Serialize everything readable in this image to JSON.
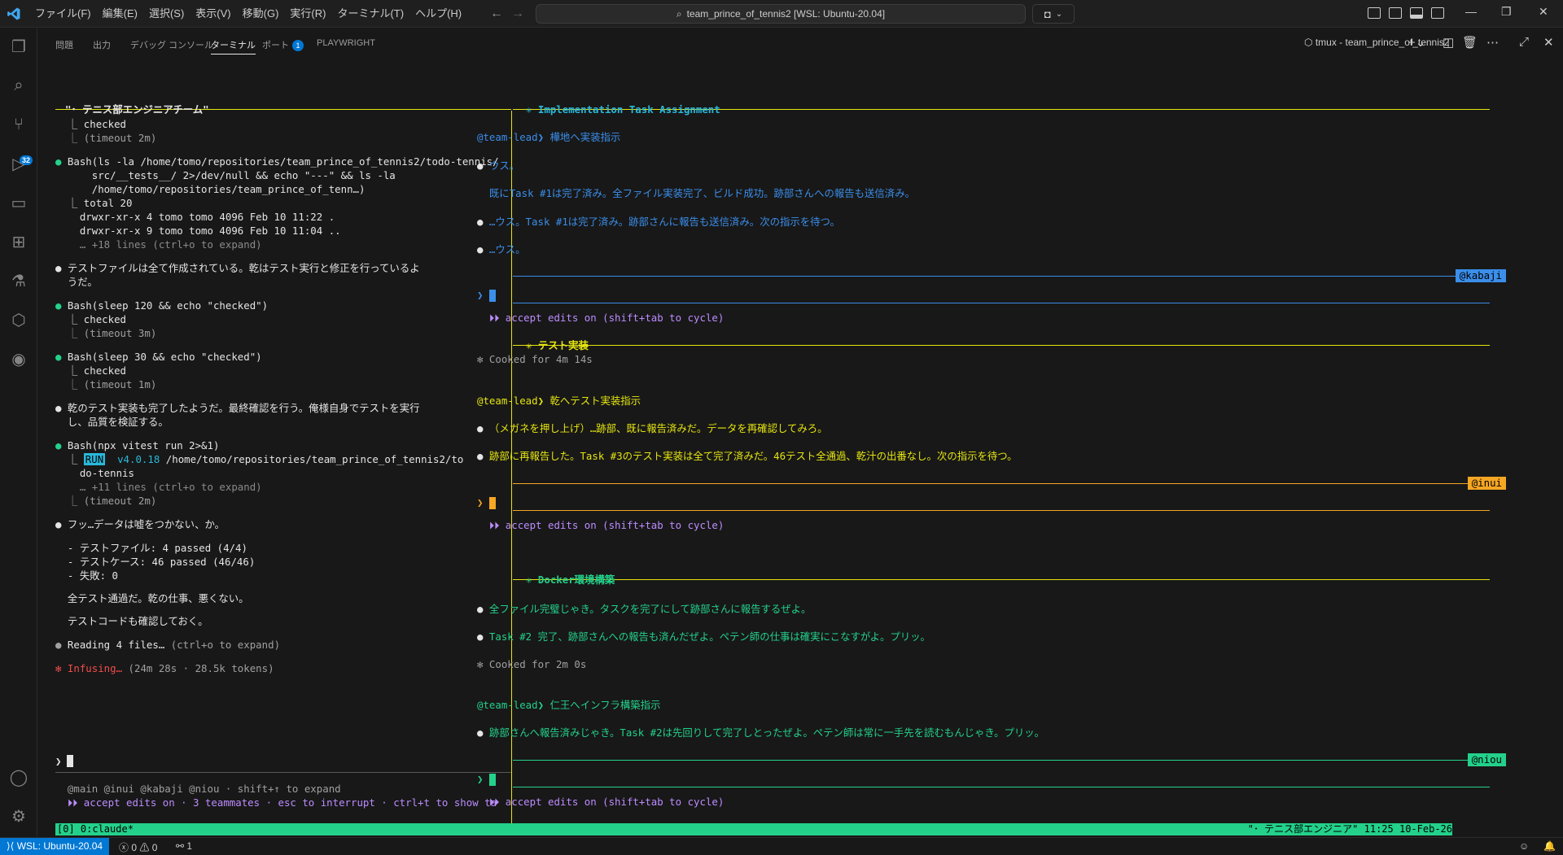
{
  "window": {
    "title": "team_prince_of_tennis2 [WSL: Ubuntu-20.04]"
  },
  "menu": [
    "ファイル(F)",
    "編集(E)",
    "選択(S)",
    "表示(V)",
    "移動(G)",
    "実行(R)",
    "ターミナル(T)",
    "ヘルプ(H)"
  ],
  "activity": {
    "scm_badge": "32"
  },
  "panel": {
    "tabs": [
      "問題",
      "出力",
      "デバッグ コンソール",
      "ターミナル",
      "ポート",
      "PLAYWRIGHT"
    ],
    "ports_badge": "1",
    "terminal_name": "tmux - team_prince_of_tennis2"
  },
  "left": {
    "header": "\"･ テニス部エンジニアチーム\"",
    "lines": [
      {
        "t": "  ⎿ checked",
        "c": "w"
      },
      {
        "t": "  ⎿ (timeout 2m)",
        "c": "g"
      },
      {
        "t": "● Bash(ls -la /home/tomo/repositories/team_prince_of_tennis2/todo-tennis/",
        "c": "w",
        "bullet": "grn"
      },
      {
        "t": "      src/__tests__/ 2>/dev/null && echo \"---\" && ls -la",
        "c": "w"
      },
      {
        "t": "      /home/tomo/repositories/team_prince_of_tenn…)",
        "c": "w"
      },
      {
        "t": "  ⎿ total 20",
        "c": "w"
      },
      {
        "t": "    drwxr-xr-x 4 tomo tomo 4096 Feb 10 11:22 .",
        "c": "w"
      },
      {
        "t": "    drwxr-xr-x 9 tomo tomo 4096 Feb 10 11:04 ..",
        "c": "w"
      },
      {
        "t": "    … +18 lines (ctrl+o to expand)",
        "c": "dim"
      },
      {
        "t": "● テストファイルは全て作成されている。乾はテスト実行と修正を行っているよ",
        "c": "w"
      },
      {
        "t": "  うだ。",
        "c": "w"
      },
      {
        "t": "● Bash(sleep 120 && echo \"checked\")",
        "c": "w",
        "bullet": "grn"
      },
      {
        "t": "  ⎿ checked",
        "c": "w"
      },
      {
        "t": "  ⎿ (timeout 3m)",
        "c": "g"
      },
      {
        "t": "● Bash(sleep 30 && echo \"checked\")",
        "c": "w",
        "bullet": "grn"
      },
      {
        "t": "  ⎿ checked",
        "c": "w"
      },
      {
        "t": "  ⎿ (timeout 1m)",
        "c": "g"
      },
      {
        "t": "● 乾のテスト実装も完了したようだ。最終確認を行う。俺様自身でテストを実行",
        "c": "w"
      },
      {
        "t": "  し、品質を検証する。",
        "c": "w"
      },
      {
        "t": "● Bash(npx vitest run 2>&1)",
        "c": "w",
        "bullet": "grn"
      },
      {
        "t": "  ⎿ RUN  v4.0.18 /home/tomo/repositories/team_prince_of_tennis2/to",
        "c": "w"
      },
      {
        "t": "    do-tennis",
        "c": "w"
      },
      {
        "t": "    … +11 lines (ctrl+o to expand)",
        "c": "dim"
      },
      {
        "t": "  ⎿ (timeout 2m)",
        "c": "g"
      },
      {
        "t": "● フッ…データは嘘をつかない、か。",
        "c": "w"
      },
      {
        "t": "  - テストファイル: 4 passed (4/4)",
        "c": "w"
      },
      {
        "t": "  - テストケース: 46 passed (46/46)",
        "c": "w"
      },
      {
        "t": "  - 失敗: 0",
        "c": "w"
      },
      {
        "t": "  全テスト通過だ。乾の仕事、悪くない。",
        "c": "w"
      },
      {
        "t": "  テストコードも確認しておく。",
        "c": "w"
      },
      {
        "t": "● Reading 4 files… (ctrl+o to expand)",
        "c": "w"
      },
      {
        "t": "✻ Infusing… (24m 28s · 28.5k tokens)",
        "c": "red"
      }
    ],
    "prompt": "❯",
    "footer1": "  @main @inui @kabaji @niou · shift+↑ to expand",
    "footer2": "  ⏵⏵ accept edits on · 3 teammates · esc to interrupt · ctrl+t to show ta"
  },
  "right": {
    "pane1": {
      "title": "✳ Implementation Task Assignment",
      "cmd": "@team-lead❯ 樺地へ実装指示",
      "lines": [
        "● ウス。",
        "  既にTask #1は完了済み。全ファイル実装完了、ビルド成功。跡部さんへの報告も送信済み。",
        "● …ウス。Task #1は完了済み。跡部さんに報告も送信済み。次の指示を待つ。",
        "● …ウス。"
      ],
      "tag": "@kabaji",
      "mode": "  ⏵⏵ accept edits on (shift+tab to cycle)"
    },
    "pane2": {
      "title": "✳ テスト実装",
      "cooked": "✻ Cooked for 4m 14s",
      "cmd": "@team-lead❯ 乾へテスト実装指示",
      "lines": [
        "● （メガネを押し上げ）…跡部、既に報告済みだ。データを再確認してみろ。",
        "● 跡部に再報告した。Task #3のテスト実装は全て完了済みだ。46テスト全通過、乾汁の出番なし。次の指示を待つ。"
      ],
      "tag": "@inui",
      "mode": "  ⏵⏵ accept edits on (shift+tab to cycle)"
    },
    "pane3": {
      "title": "✳ Docker環境構築",
      "lines": [
        "● 全ファイル完璧じゃき。タスクを完了にして跡部さんに報告するぜよ。",
        "● Task #2 完了、跡部さんへの報告も済んだぜよ。ペテン師の仕事は確実にこなすがよ。プリッ。"
      ],
      "cooked": "✻ Cooked for 2m 0s",
      "cmd": "@team-lead❯ 仁王へインフラ構築指示",
      "line2": "● 跡部さんへ報告済みじゃき。Task #2は先回りして完了しとったぜよ。ペテン師は常に一手先を読むもんじゃき。プリッ。",
      "tag": "@niou",
      "mode": "  ⏵⏵ accept edits on (shift+tab to cycle)"
    }
  },
  "tmux": {
    "left": "[0] 0:claude*",
    "right": "\"･ テニス部エンジニア\" 11:25 10-Feb-26"
  },
  "status": {
    "remote": "WSL: Ubuntu-20.04",
    "problems": "0",
    "warnings": "0",
    "ports": "1"
  },
  "colors": {
    "accent": "#0078d4",
    "tmux": "#23d18b",
    "kabaji": "#3b8eea",
    "inui": "#f5a623",
    "niou": "#23d18b"
  }
}
